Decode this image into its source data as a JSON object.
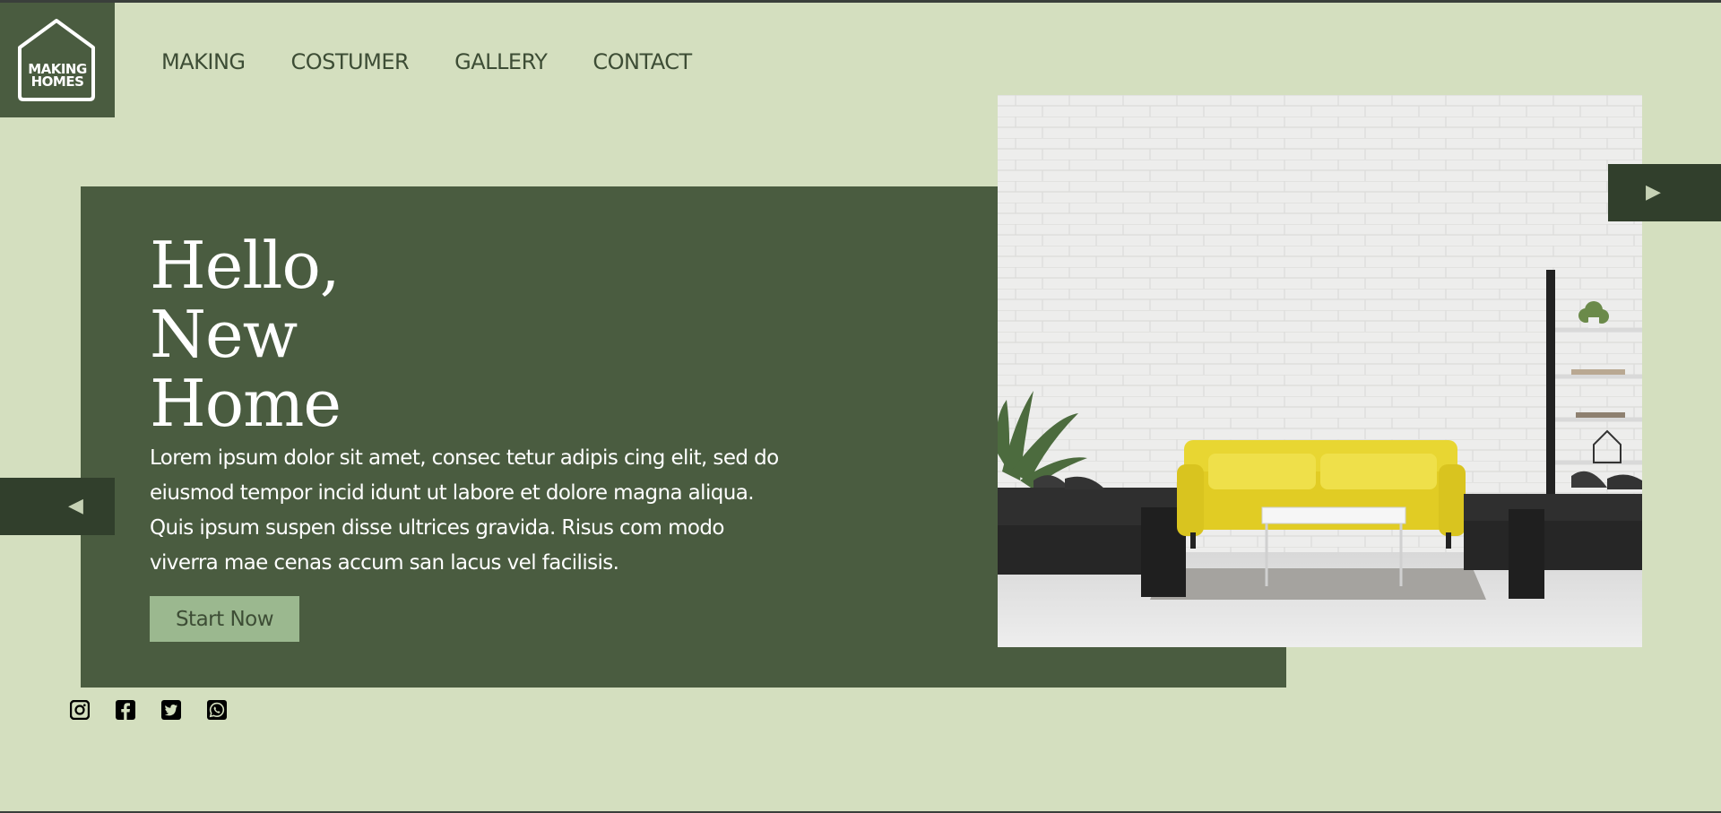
{
  "brand": {
    "logo_line1": "MAKING",
    "logo_line2": "HOMES",
    "panel_color": "#4a5c40",
    "background_color": "#d4dfbf",
    "button_color": "#9bb88f"
  },
  "nav": {
    "items": [
      {
        "label": "MAKING"
      },
      {
        "label": "COSTUMER"
      },
      {
        "label": "GALLERY"
      },
      {
        "label": "CONTACT"
      }
    ]
  },
  "hero": {
    "headline": [
      "Hello,",
      "New",
      "Home"
    ],
    "body": "Lorem ipsum dolor sit amet, consec tetur adipis cing elit, sed do eiusmod tempor incid idunt ut labore et dolore magna aliqua. Quis ipsum suspen disse ultrices gravida. Risus com modo viverra mae cenas accum san lacus vel facilisis.",
    "cta_label": "Start Now",
    "image_icon": "living-room-photo"
  },
  "carousel": {
    "next_icon": "play-right-icon",
    "prev_icon": "play-left-icon",
    "next_glyph": "▶",
    "prev_glyph": "◀"
  },
  "social": {
    "icons": [
      "instagram-icon",
      "facebook-icon",
      "twitter-icon",
      "whatsapp-icon"
    ]
  }
}
